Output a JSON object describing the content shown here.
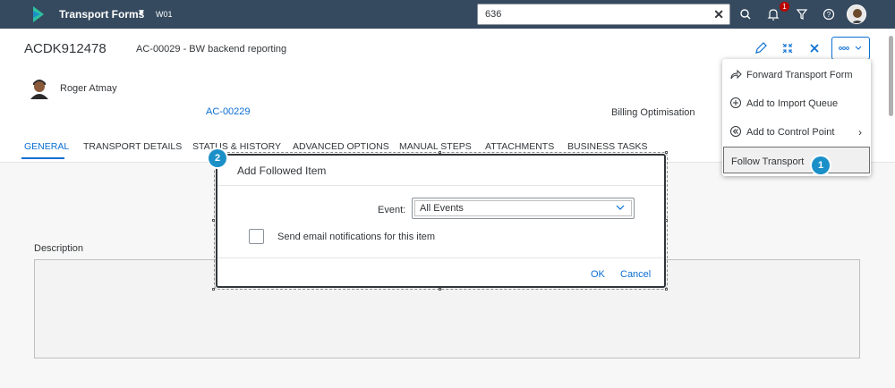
{
  "shell": {
    "app_title": "Transport Forms",
    "system": "W01",
    "search_value": "636",
    "notification_count": "1"
  },
  "header": {
    "object_id": "ACDK912478",
    "object_subtitle": "AC-00029 - BW backend reporting",
    "person_name": "Roger Atmay",
    "ac_link": "AC-00229",
    "billing": "Billing Optimisation"
  },
  "tabs": [
    {
      "label": "GENERAL"
    },
    {
      "label": "TRANSPORT DETAILS"
    },
    {
      "label": "STATUS & HISTORY"
    },
    {
      "label": "ADVANCED OPTIONS"
    },
    {
      "label": "MANUAL STEPS"
    },
    {
      "label": "ATTACHMENTS"
    },
    {
      "label": "BUSINESS TASKS"
    }
  ],
  "content": {
    "description_label": "Description"
  },
  "menu": {
    "items": [
      {
        "label": "Forward Transport Form",
        "icon": "forward-icon"
      },
      {
        "label": "Add to Import Queue",
        "icon": "add-circle-icon"
      },
      {
        "label": "Add to Control Point",
        "icon": "rewind-circle-icon"
      },
      {
        "label": "Follow Transport",
        "icon": ""
      }
    ]
  },
  "steps": {
    "one": "1",
    "two": "2"
  },
  "dialog": {
    "title": "Add Followed Item",
    "event_label": "Event:",
    "event_value": "All Events",
    "checkbox_label": "Send email notifications for this item",
    "ok_label": "OK",
    "cancel_label": "Cancel"
  },
  "colors": {
    "shell": "#354a5f",
    "accent": "#0a6ed1",
    "badge": "#1b90c8",
    "notification": "#bb0000"
  }
}
